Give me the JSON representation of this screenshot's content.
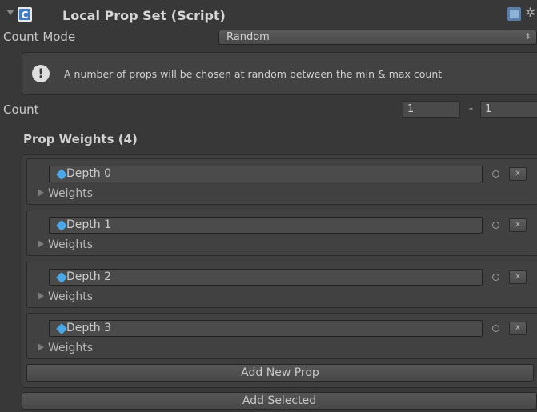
{
  "header": {
    "title": "Local Prop Set (Script)",
    "script_icon": "script-icon",
    "help_icon": "help-icon",
    "settings_icon": "gear-icon"
  },
  "count_mode": {
    "label": "Count Mode",
    "value": "Random"
  },
  "help_message": "A number of props will be chosen at random between the min & max count",
  "count": {
    "label": "Count",
    "min": "1",
    "separator": "-",
    "max": "1"
  },
  "prop_weights": {
    "title": "Prop Weights (4)",
    "items": [
      {
        "object": "Depth 0",
        "weights_label": "Weights",
        "remove_label": "x"
      },
      {
        "object": "Depth 1",
        "weights_label": "Weights",
        "remove_label": "x"
      },
      {
        "object": "Depth 2",
        "weights_label": "Weights",
        "remove_label": "x"
      },
      {
        "object": "Depth 3",
        "weights_label": "Weights",
        "remove_label": "x"
      }
    ]
  },
  "buttons": {
    "add_new_prop": "Add New Prop",
    "add_selected": "Add Selected"
  }
}
